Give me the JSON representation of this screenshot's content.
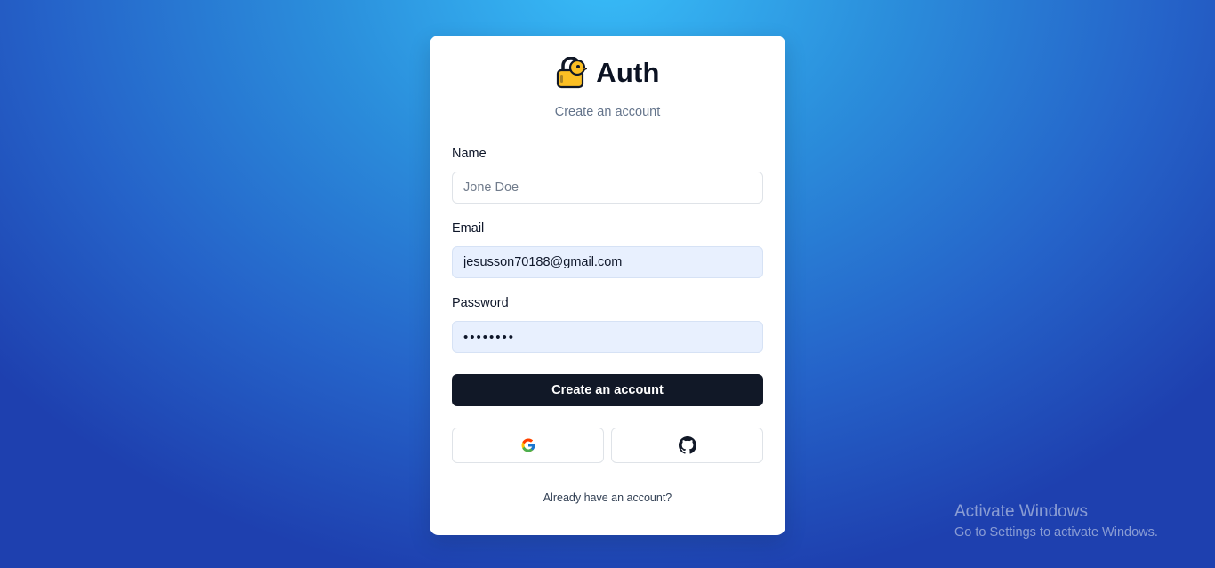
{
  "brand": {
    "title": "Auth",
    "icon": "lock-bird-icon"
  },
  "subtitle": "Create an account",
  "form": {
    "name": {
      "label": "Name",
      "placeholder": "Jone Doe",
      "value": ""
    },
    "email": {
      "label": "Email",
      "placeholder": "",
      "value": "jesusson70188@gmail.com"
    },
    "password": {
      "label": "Password",
      "placeholder": "",
      "value": "password"
    },
    "submit_label": "Create an account"
  },
  "oauth": {
    "google_icon": "google-icon",
    "github_icon": "github-icon"
  },
  "footer_link": "Already have an account?",
  "watermark": {
    "title": "Activate Windows",
    "subtitle": "Go to Settings to activate Windows."
  },
  "colors": {
    "primary_button": "#111827",
    "autofill_background": "#e8f0fe",
    "background_top": "#38bdf8",
    "background_bottom": "#1e40af"
  }
}
